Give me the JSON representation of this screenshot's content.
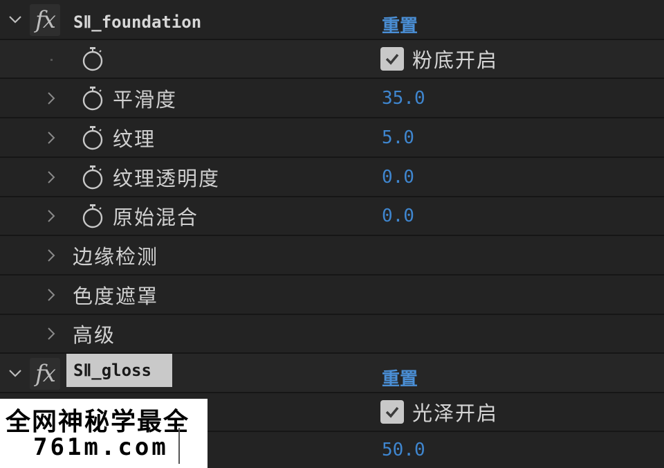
{
  "effects": [
    {
      "name": "SⅡ_foundation",
      "reset_label": "重置",
      "checkbox": {
        "label": "粉底开启",
        "checked": true
      },
      "params": [
        {
          "label": "平滑度",
          "value": "35.0"
        },
        {
          "label": "纹理",
          "value": "5.0"
        },
        {
          "label": "纹理透明度",
          "value": "0.0"
        },
        {
          "label": "原始混合",
          "value": "0.0"
        }
      ],
      "groups": [
        "边缘检测",
        "色度遮罩",
        "高级"
      ]
    },
    {
      "name": "SⅡ_gloss",
      "reset_label": "重置",
      "checkbox": {
        "label": "光泽开启",
        "checked": true
      },
      "params": [
        {
          "label": "",
          "value": "50.0"
        }
      ]
    }
  ],
  "watermark": {
    "line1": "全网神秘学最全",
    "line2": "761m.com"
  },
  "colors": {
    "accent": "#3f86cf",
    "background": "#232323",
    "row_divider": "#161616"
  },
  "icons": {
    "twirl": "chevron-icon",
    "fx": "fx-icon",
    "stopwatch": "stopwatch-icon",
    "check": "check-icon"
  }
}
